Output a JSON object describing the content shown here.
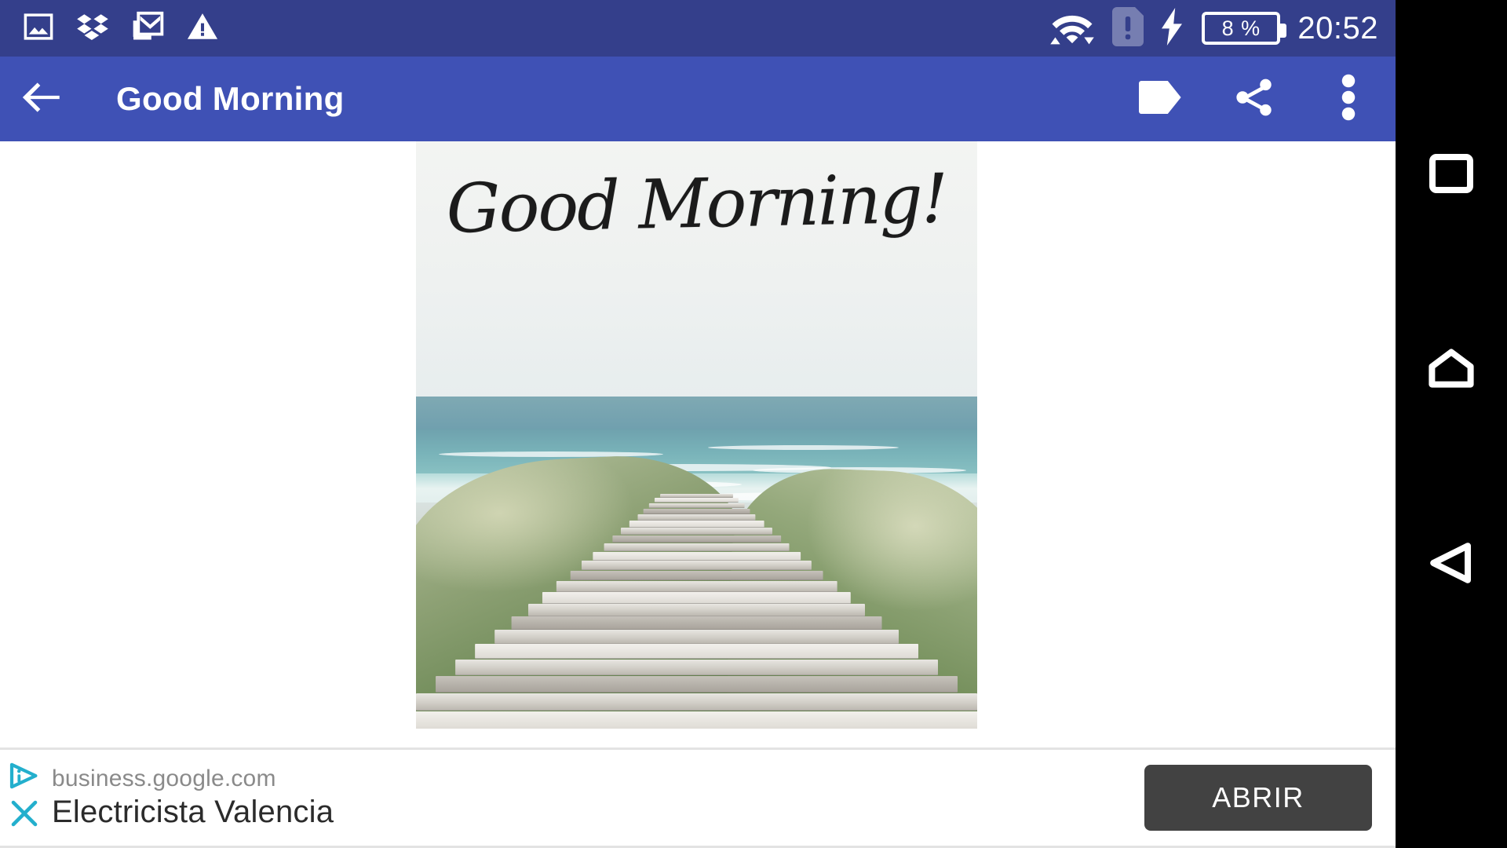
{
  "status_bar": {
    "background_color": "#343F8B",
    "left_icons": [
      {
        "name": "gallery-image-icon",
        "label": "Gallery"
      },
      {
        "name": "dropbox-icon",
        "label": "Dropbox"
      },
      {
        "name": "gmail-icon",
        "label": "Gmail"
      },
      {
        "name": "warning-triangle-icon",
        "label": "Warning"
      }
    ],
    "right_icons": [
      {
        "name": "wifi-icon",
        "label": "Wi-Fi"
      },
      {
        "name": "sim-card-alert-icon",
        "label": "No SIM"
      },
      {
        "name": "charging-bolt-icon",
        "label": "Charging"
      }
    ],
    "battery_percent": "8 %",
    "clock": "20:52"
  },
  "app_bar": {
    "background_color": "#3F51B5",
    "title": "Good Morning",
    "back_icon": "arrow-back-icon",
    "actions": [
      {
        "name": "tag-icon",
        "label": "Tag"
      },
      {
        "name": "share-icon",
        "label": "Share"
      },
      {
        "name": "overflow-menu-icon",
        "label": "More options"
      }
    ]
  },
  "content": {
    "image": {
      "overlay_text": "Good Morning!",
      "description": "Wooden boardwalk through beach dune grass leading to the ocean"
    }
  },
  "ad_banner": {
    "info_icon": "adchoices-info-icon",
    "close_icon": "close-x-icon",
    "icon_color": "#23AFCD",
    "url": "business.google.com",
    "title": "Electricista Valencia",
    "cta_label": "ABRIR",
    "cta_color": "#424242"
  },
  "nav_bar": {
    "background_color": "#000000",
    "buttons": [
      {
        "name": "recents-button",
        "icon": "square-icon",
        "label": "Recent apps"
      },
      {
        "name": "home-button",
        "icon": "home-icon",
        "label": "Home"
      },
      {
        "name": "back-button",
        "icon": "back-triangle-icon",
        "label": "Back"
      }
    ]
  }
}
